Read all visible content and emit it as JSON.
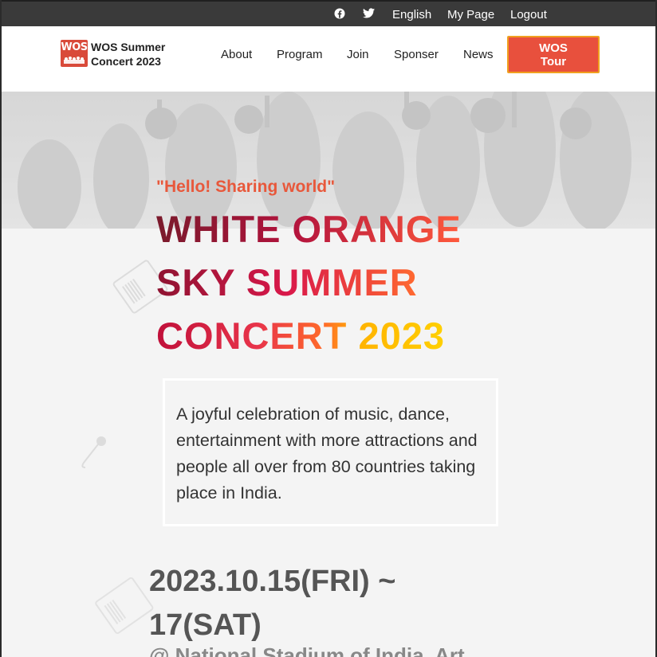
{
  "utility_bar": {
    "icons": [
      "facebook-icon",
      "twitter-icon"
    ],
    "language": "English",
    "my_page": "My Page",
    "logout": "Logout"
  },
  "brand": {
    "logo_text": "WOS",
    "name_line1": "WOS Summer",
    "name_line2": "Concert 2023"
  },
  "nav": {
    "items": [
      "About",
      "Program",
      "Join",
      "Sponser",
      "News"
    ],
    "cta_line1": "WOS",
    "cta_line2": "Tour"
  },
  "hero": {
    "tagline": "\"Hello! Sharing world\"",
    "title_line1": "WHITE ORANGE",
    "title_line2": "SKY SUMMER",
    "title_line3": "CONCERT 2023",
    "description": "A joyful celebration of music, dance, entertainment with more attractions and people all over from 80 countries taking place in India.",
    "date": "2023.10.15(FRI) ~ 17(SAT)",
    "venue": "@ National Stadium of India, Art"
  },
  "colors": {
    "utility_bg": "#3a3a3a",
    "accent": "#e8503d",
    "cta_border": "#f0a020",
    "hero_bg": "#f4f4f4",
    "tagline": "#e8583b"
  }
}
